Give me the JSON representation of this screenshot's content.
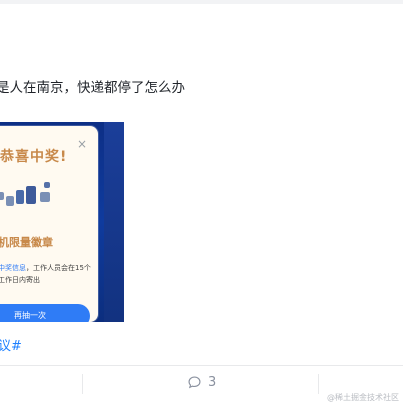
{
  "post": {
    "text": "是人在南京，快递都停了怎么办",
    "hashtag": "议#"
  },
  "image": {
    "popup": {
      "close_symbol": "×",
      "title": "恭喜中奖!",
      "prize_name": "机限量徽章",
      "desc_highlight": "中奖信息",
      "desc_rest": "，工作人员会在15个工作日内寄出",
      "button_label": "再抽一次"
    }
  },
  "actions": {
    "comment_count": "3"
  },
  "watermark": "@稀土掘金技术社区",
  "colors": {
    "accent": "#1e80ff",
    "gold": "#c8894a",
    "button": "#2f7cf6",
    "image_bg": "#0f3b9e"
  }
}
